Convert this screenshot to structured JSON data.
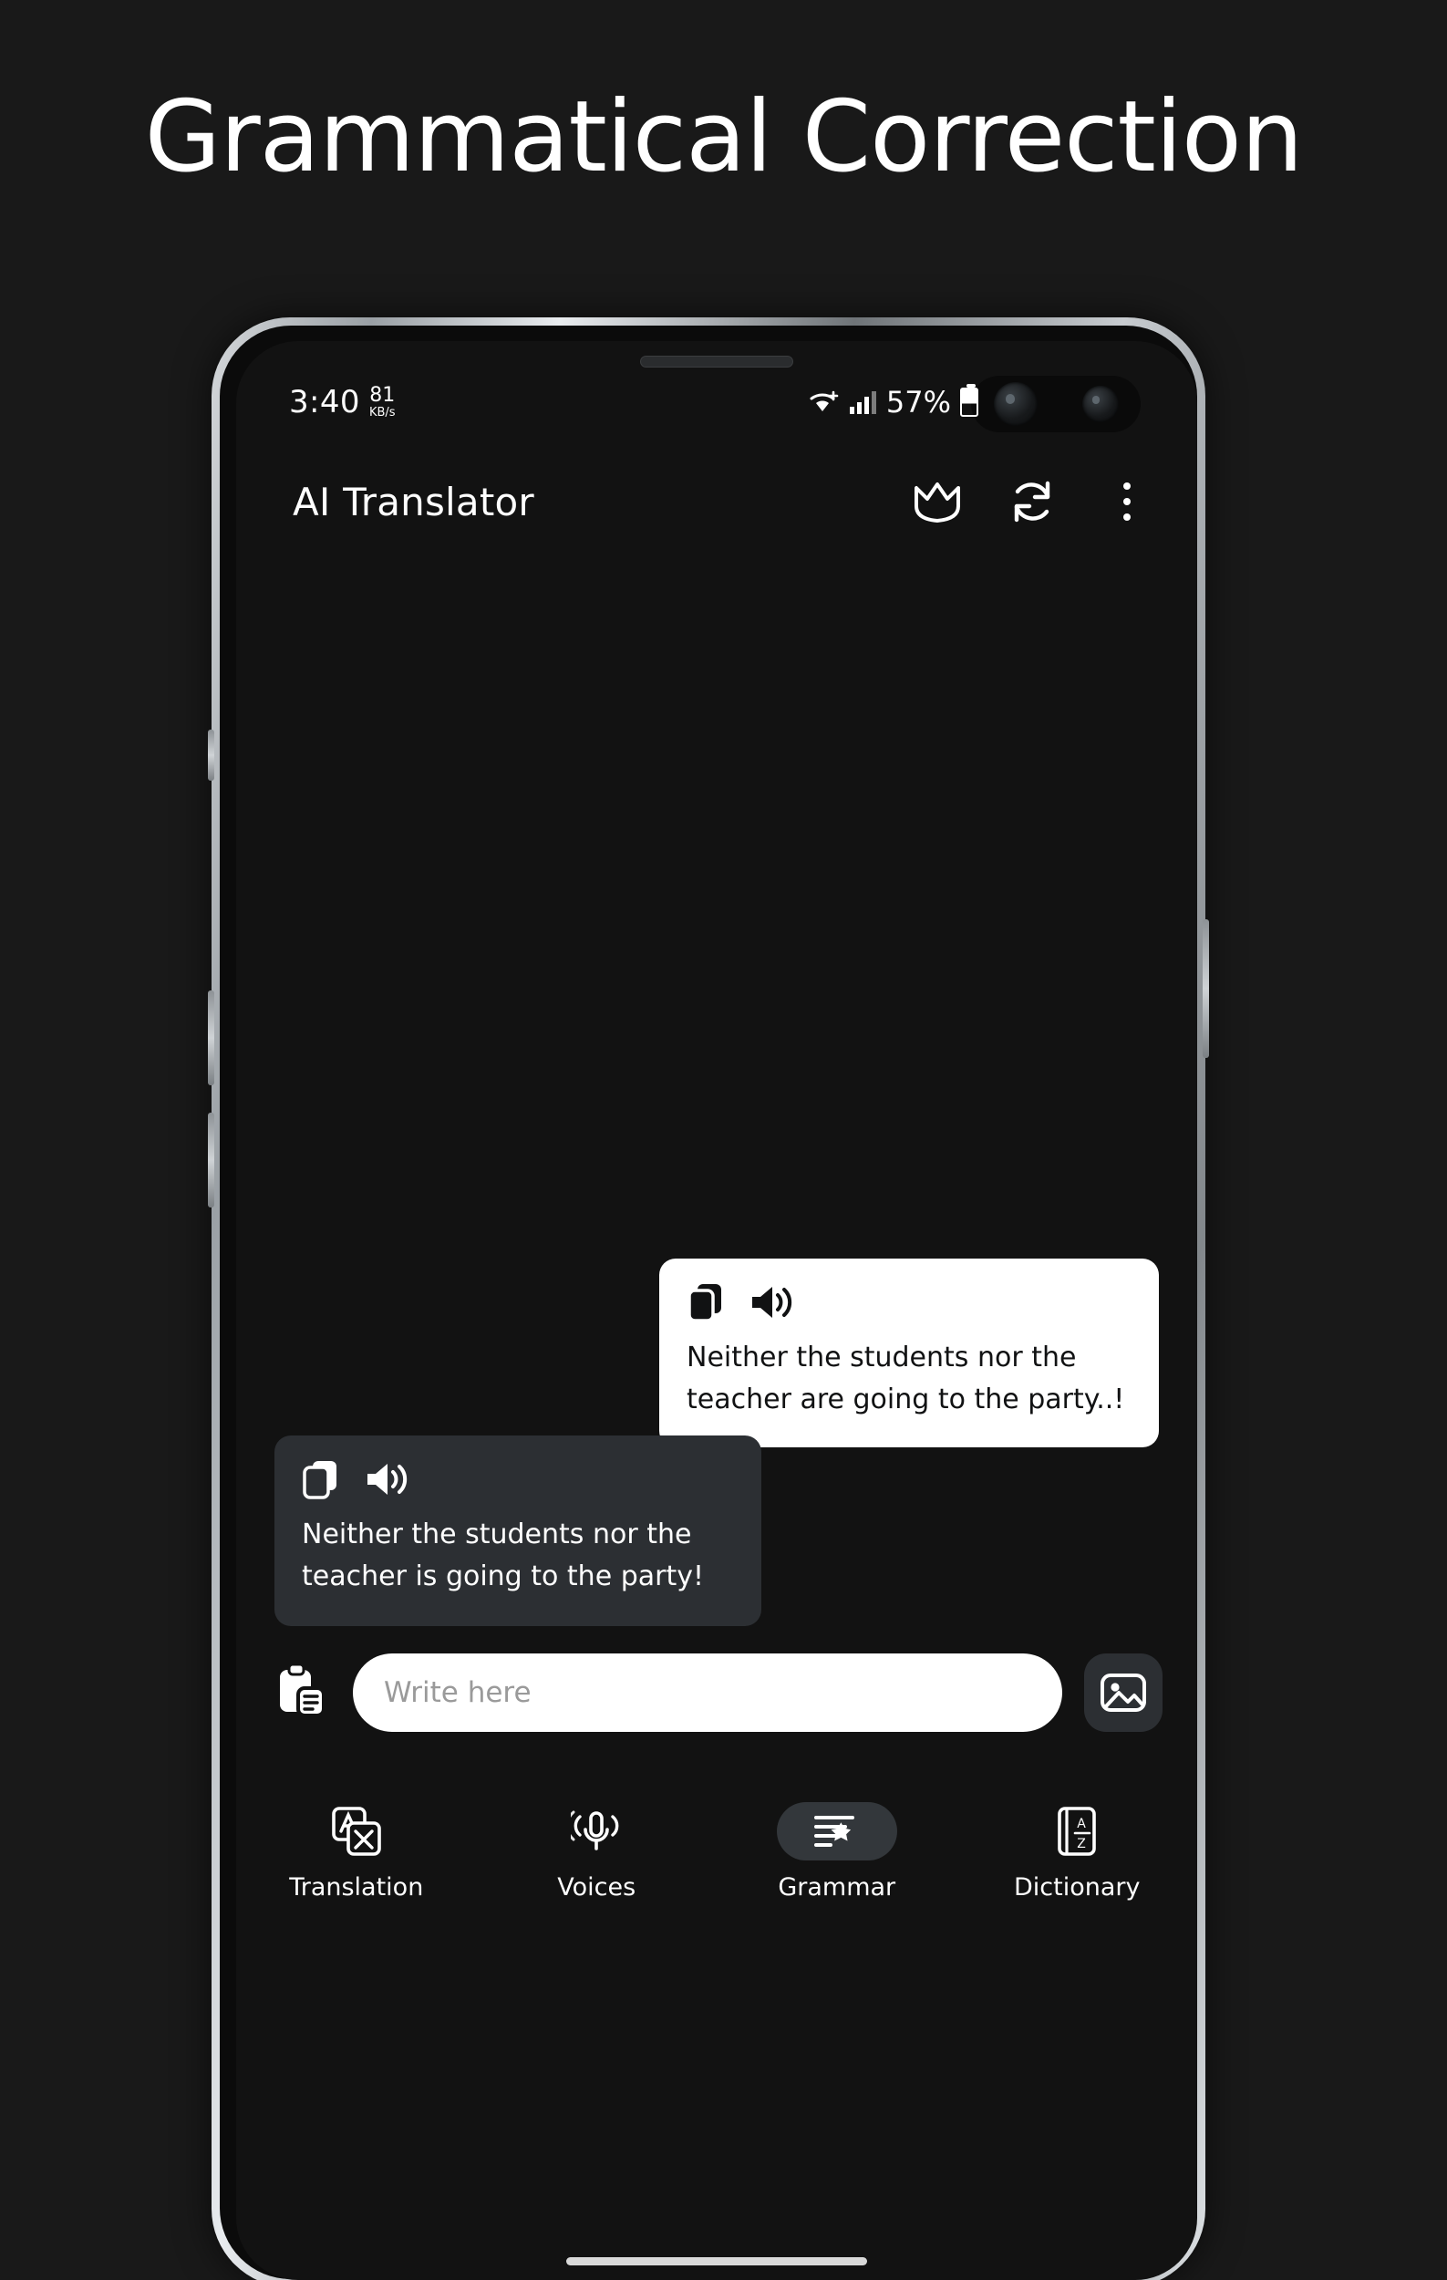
{
  "headline": "Grammatical Correction",
  "phone": {
    "status_bar": {
      "time": "3:40",
      "data_rate_value": "81",
      "data_rate_unit": "KB/s",
      "battery_percent": "57%"
    },
    "app_bar": {
      "title": "AI Translator",
      "crown_icon": "crown-icon",
      "refresh_icon": "refresh-icon",
      "overflow_icon": "kebab-menu-icon"
    },
    "chat": {
      "messages": [
        {
          "side": "outgoing",
          "text": "Neither the students nor the teacher are going to the party..!",
          "copy_icon": "copy-icon",
          "speak_icon": "speaker-icon"
        },
        {
          "side": "incoming",
          "text": "Neither the students nor the teacher is going to the party!",
          "copy_icon": "copy-icon",
          "speak_icon": "speaker-icon"
        }
      ]
    },
    "input": {
      "paste_icon": "clipboard-paste-icon",
      "placeholder": "Write here",
      "value": "",
      "image_icon": "image-picker-icon"
    },
    "bottom_nav": {
      "items": [
        {
          "label": "Translation",
          "icon": "translate-icon",
          "active": false
        },
        {
          "label": "Voices",
          "icon": "microphone-icon",
          "active": false
        },
        {
          "label": "Grammar",
          "icon": "grammar-wand-icon",
          "active": true
        },
        {
          "label": "Dictionary",
          "icon": "dictionary-book-icon",
          "active": false
        }
      ]
    }
  },
  "colors": {
    "background": "#191919",
    "screen": "#121212",
    "bubble_in": "#2c2f33",
    "bubble_out": "#ffffff",
    "accent_pill": "#33373b"
  }
}
